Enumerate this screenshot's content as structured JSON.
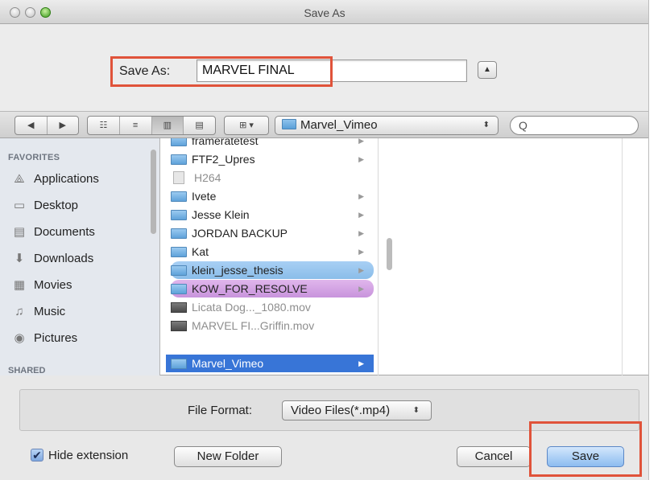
{
  "window": {
    "title": "Save As"
  },
  "save_as": {
    "label": "Save As:",
    "value": "MARVEL FINAL",
    "expand_glyph": "▲"
  },
  "toolbar": {
    "back_glyph": "◀",
    "forward_glyph": "▶",
    "view_icon_glyph": "☷",
    "view_list_glyph": "≡",
    "view_column_glyph": "▥",
    "view_flow_glyph": "▤",
    "arrange_glyph": "⊞ ▾",
    "path_folder": "Marvel_Vimeo",
    "path_arrows": "⬍",
    "search_glyph": "Q"
  },
  "sidebar": {
    "favorites_header": "FAVORITES",
    "items": [
      {
        "label": "Applications",
        "glyph": "⟁"
      },
      {
        "label": "Desktop",
        "glyph": "▭"
      },
      {
        "label": "Documents",
        "glyph": "▤"
      },
      {
        "label": "Downloads",
        "glyph": "⬇"
      },
      {
        "label": "Movies",
        "glyph": "▦"
      },
      {
        "label": "Music",
        "glyph": "♫"
      },
      {
        "label": "Pictures",
        "glyph": "◉"
      }
    ],
    "shared_header": "SHARED"
  },
  "files": [
    {
      "name": "frameratetest",
      "kind": "folder",
      "style": ""
    },
    {
      "name": "FTF2_Upres",
      "kind": "folder",
      "style": ""
    },
    {
      "name": "H264",
      "kind": "doc",
      "style": "dim"
    },
    {
      "name": "Ivete",
      "kind": "folder",
      "style": ""
    },
    {
      "name": "Jesse Klein",
      "kind": "folder",
      "style": ""
    },
    {
      "name": "JORDAN BACKUP",
      "kind": "folder",
      "style": ""
    },
    {
      "name": "Kat",
      "kind": "folder",
      "style": ""
    },
    {
      "name": "klein_jesse_thesis",
      "kind": "folder",
      "style": "tag-blue"
    },
    {
      "name": "KOW_FOR_RESOLVE",
      "kind": "folder",
      "style": "tag-purple"
    },
    {
      "name": "Licata Dog..._1080.mov",
      "kind": "mov",
      "style": "dim"
    },
    {
      "name": "MARVEL FI...Griffin.mov",
      "kind": "mov",
      "style": "dim"
    },
    {
      "name": "Marvel_Vimeo",
      "kind": "folder",
      "style": "selected"
    }
  ],
  "format": {
    "label": "File Format:",
    "value": "Video Files(*.mp4)",
    "arrows": "⬍"
  },
  "bottom": {
    "hide_extension_label": "Hide extension",
    "check_glyph": "✔",
    "new_folder_label": "New Folder",
    "cancel_label": "Cancel",
    "save_label": "Save"
  },
  "colors": {
    "annotation": "#e0533a",
    "selection": "#3875d7",
    "tag_blue": "#8abde9",
    "tag_purple": "#c894dc"
  }
}
